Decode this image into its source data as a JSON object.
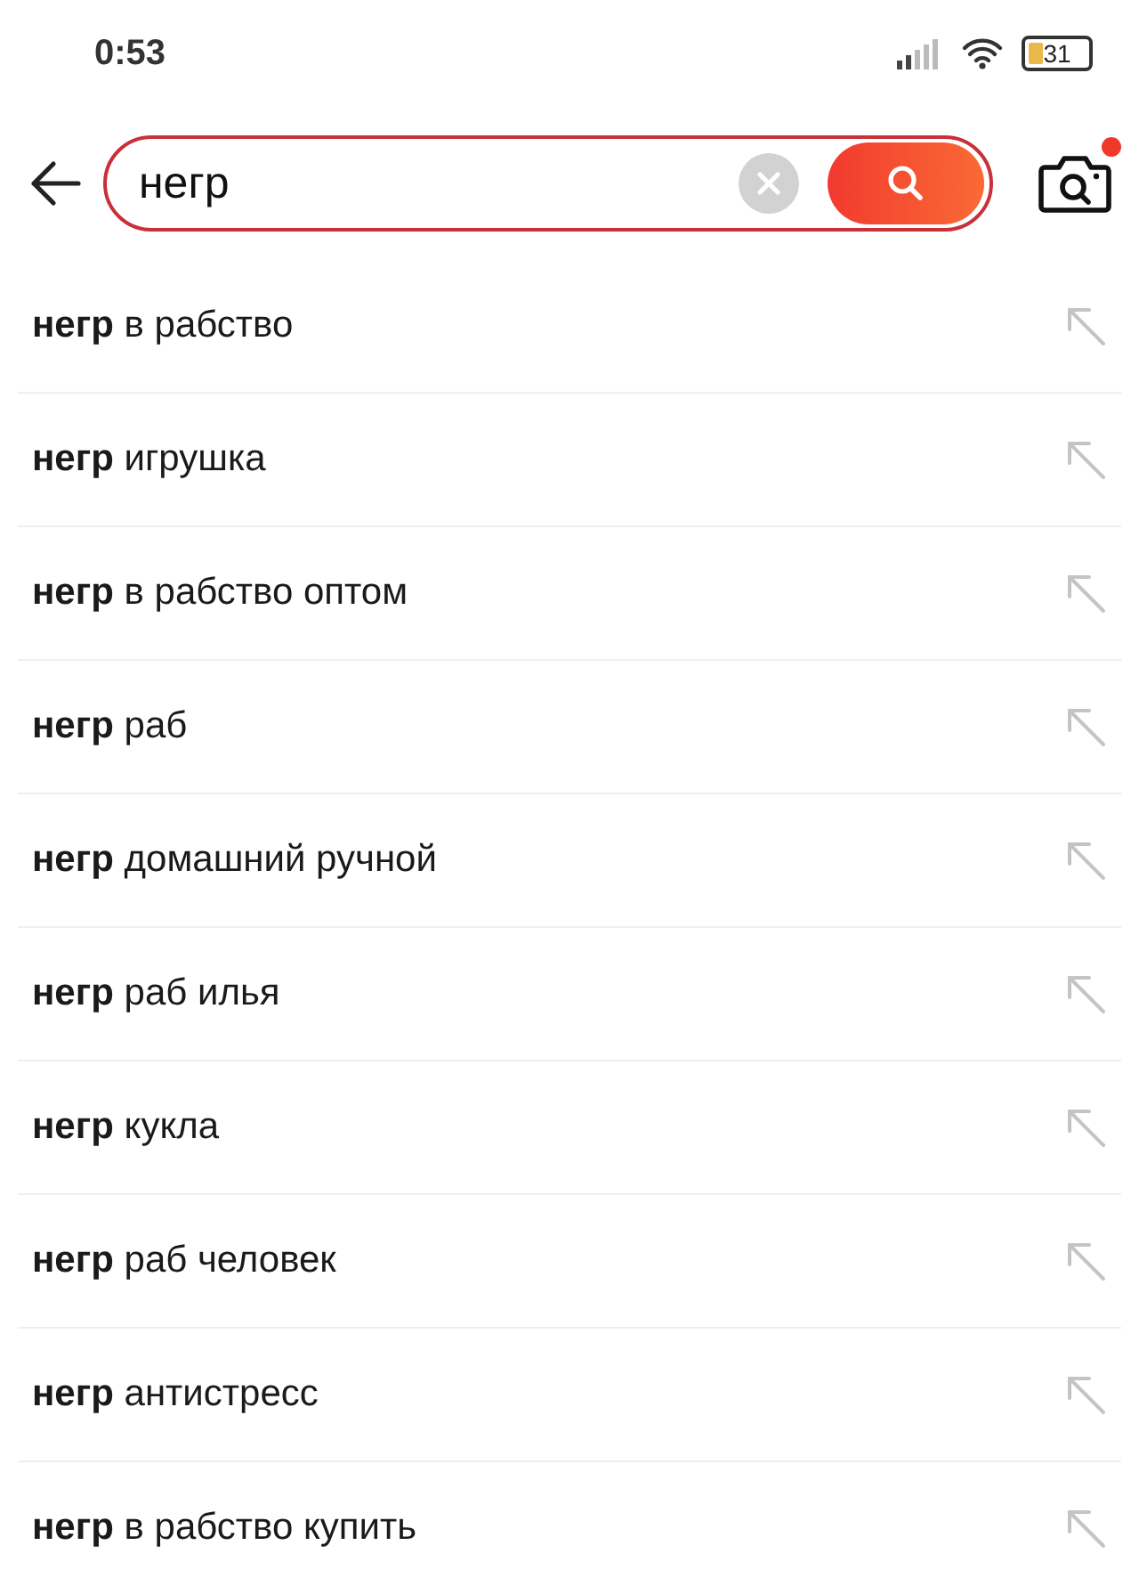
{
  "status_bar": {
    "time": "0:53",
    "battery": "31"
  },
  "search": {
    "value": "негр",
    "camera_badge": true
  },
  "suggestions": [
    {
      "text": "**негр** в рабство"
    },
    {
      "text": "**негр** игрушка"
    },
    {
      "text": "**негр** в рабство оптом"
    },
    {
      "text": "**негр** раб"
    },
    {
      "text": "**негр** домашний ручной"
    },
    {
      "text": "**негр** раб илья"
    },
    {
      "text": "**негр** кукла"
    },
    {
      "text": "**негр** раб человек"
    },
    {
      "text": "**негр** антистресс"
    },
    {
      "text": "**негр** в рабство купить"
    }
  ]
}
